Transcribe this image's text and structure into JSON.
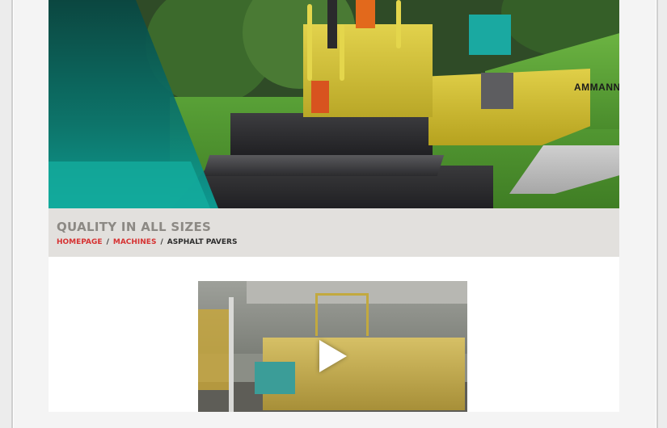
{
  "hero": {
    "brand_text": "AMMANN"
  },
  "page": {
    "title": "QUALITY IN ALL SIZES"
  },
  "breadcrumb": {
    "items": [
      {
        "label": "HOMEPAGE",
        "link": true
      },
      {
        "label": "MACHINES",
        "link": true
      },
      {
        "label": "ASPHALT PAVERS",
        "link": false
      }
    ],
    "separator": "/"
  },
  "video": {
    "icon": "play-icon"
  },
  "colors": {
    "accent_red": "#d63232",
    "title_gray": "#8c8984",
    "band_bg": "#e2e0dd",
    "teal": "#1aa9a1"
  }
}
